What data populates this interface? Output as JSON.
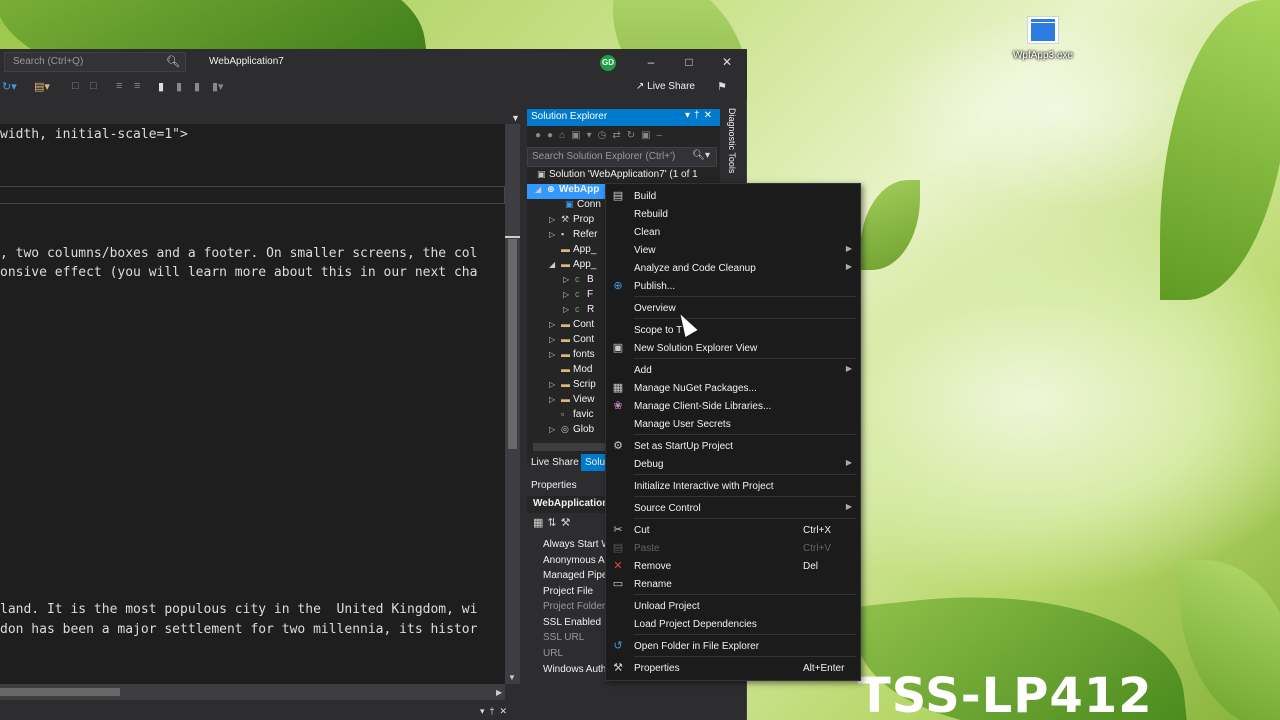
{
  "desktop": {
    "icon_label": "WpfApp3.exe",
    "watermark": "TSS-LP412"
  },
  "window": {
    "search_placeholder": "Search (Ctrl+Q)",
    "title": "WebApplication7",
    "avatar_initials": "GD",
    "live_share": "Live Share"
  },
  "editor": {
    "lines": [
      "width, initial-scale=1\">",
      ", two columns/boxes and a footer. On smaller screens, the col",
      "onsive effect (you will learn more about this in our next cha",
      "land. It is the most populous city in the  United Kingdom, wi",
      "don has been a major settlement for two millennia, its histor"
    ]
  },
  "solution_explorer": {
    "title": "Solution Explorer",
    "search_placeholder": "Search Solution Explorer (Ctrl+')",
    "tree": [
      "Solution 'WebApplication7' (1 of 1",
      "WebApp",
      "Conn",
      "Prop",
      "Refer",
      "App_",
      "App_",
      "B",
      "F",
      "R",
      "Cont",
      "Cont",
      "fonts",
      "Mod",
      "Scrip",
      "View",
      "favic",
      "Glob"
    ],
    "bottom_tabs": [
      "Live Share",
      "Solu"
    ]
  },
  "side_strip": "Diagnostic Tools",
  "properties": {
    "header": "Properties",
    "object": "WebApplication",
    "rows": [
      "Always Start W",
      "Anonymous A",
      "Managed Pipe",
      "Project File",
      "Project Folder",
      "SSL Enabled",
      "SSL URL",
      "URL",
      "Windows Auth"
    ]
  },
  "context_menu": {
    "items": [
      {
        "label": "Build",
        "icon": "build-icon",
        "shortcut": "",
        "submenu": false,
        "disabled": false
      },
      {
        "label": "Rebuild",
        "icon": "",
        "shortcut": "",
        "submenu": false,
        "disabled": false
      },
      {
        "label": "Clean",
        "icon": "",
        "shortcut": "",
        "submenu": false,
        "disabled": false
      },
      {
        "label": "View",
        "icon": "",
        "shortcut": "",
        "submenu": true,
        "disabled": false
      },
      {
        "label": "Analyze and Code Cleanup",
        "icon": "",
        "shortcut": "",
        "submenu": true,
        "disabled": false
      },
      {
        "label": "Publish...",
        "icon": "globe-icon",
        "shortcut": "",
        "submenu": false,
        "disabled": false
      },
      {
        "label": "Overview",
        "icon": "",
        "shortcut": "",
        "submenu": false,
        "disabled": false
      },
      {
        "label": "Scope to T",
        "icon": "",
        "shortcut": "",
        "submenu": false,
        "disabled": false
      },
      {
        "label": "New Solution Explorer View",
        "icon": "new-view-icon",
        "shortcut": "",
        "submenu": false,
        "disabled": false
      },
      {
        "label": "Add",
        "icon": "",
        "shortcut": "",
        "submenu": true,
        "disabled": false
      },
      {
        "label": "Manage NuGet Packages...",
        "icon": "nuget-icon",
        "shortcut": "",
        "submenu": false,
        "disabled": false
      },
      {
        "label": "Manage Client-Side Libraries...",
        "icon": "library-icon",
        "shortcut": "",
        "submenu": false,
        "disabled": false
      },
      {
        "label": "Manage User Secrets",
        "icon": "",
        "shortcut": "",
        "submenu": false,
        "disabled": false
      },
      {
        "label": "Set as StartUp Project",
        "icon": "gear-icon",
        "shortcut": "",
        "submenu": false,
        "disabled": false
      },
      {
        "label": "Debug",
        "icon": "",
        "shortcut": "",
        "submenu": true,
        "disabled": false
      },
      {
        "label": "Initialize Interactive with Project",
        "icon": "",
        "shortcut": "",
        "submenu": false,
        "disabled": false
      },
      {
        "label": "Source Control",
        "icon": "",
        "shortcut": "",
        "submenu": true,
        "disabled": false
      },
      {
        "label": "Cut",
        "icon": "scissors-icon",
        "shortcut": "Ctrl+X",
        "submenu": false,
        "disabled": false
      },
      {
        "label": "Paste",
        "icon": "paste-icon",
        "shortcut": "Ctrl+V",
        "submenu": false,
        "disabled": true
      },
      {
        "label": "Remove",
        "icon": "remove-icon",
        "shortcut": "Del",
        "submenu": false,
        "disabled": false
      },
      {
        "label": "Rename",
        "icon": "rename-icon",
        "shortcut": "",
        "submenu": false,
        "disabled": false
      },
      {
        "label": "Unload Project",
        "icon": "",
        "shortcut": "",
        "submenu": false,
        "disabled": false
      },
      {
        "label": "Load Project Dependencies",
        "icon": "",
        "shortcut": "",
        "submenu": false,
        "disabled": false
      },
      {
        "label": "Open Folder in File Explorer",
        "icon": "refresh-arrow-icon",
        "shortcut": "",
        "submenu": false,
        "disabled": false
      },
      {
        "label": "Properties",
        "icon": "wrench-icon",
        "shortcut": "Alt+Enter",
        "submenu": false,
        "disabled": false
      }
    ]
  }
}
